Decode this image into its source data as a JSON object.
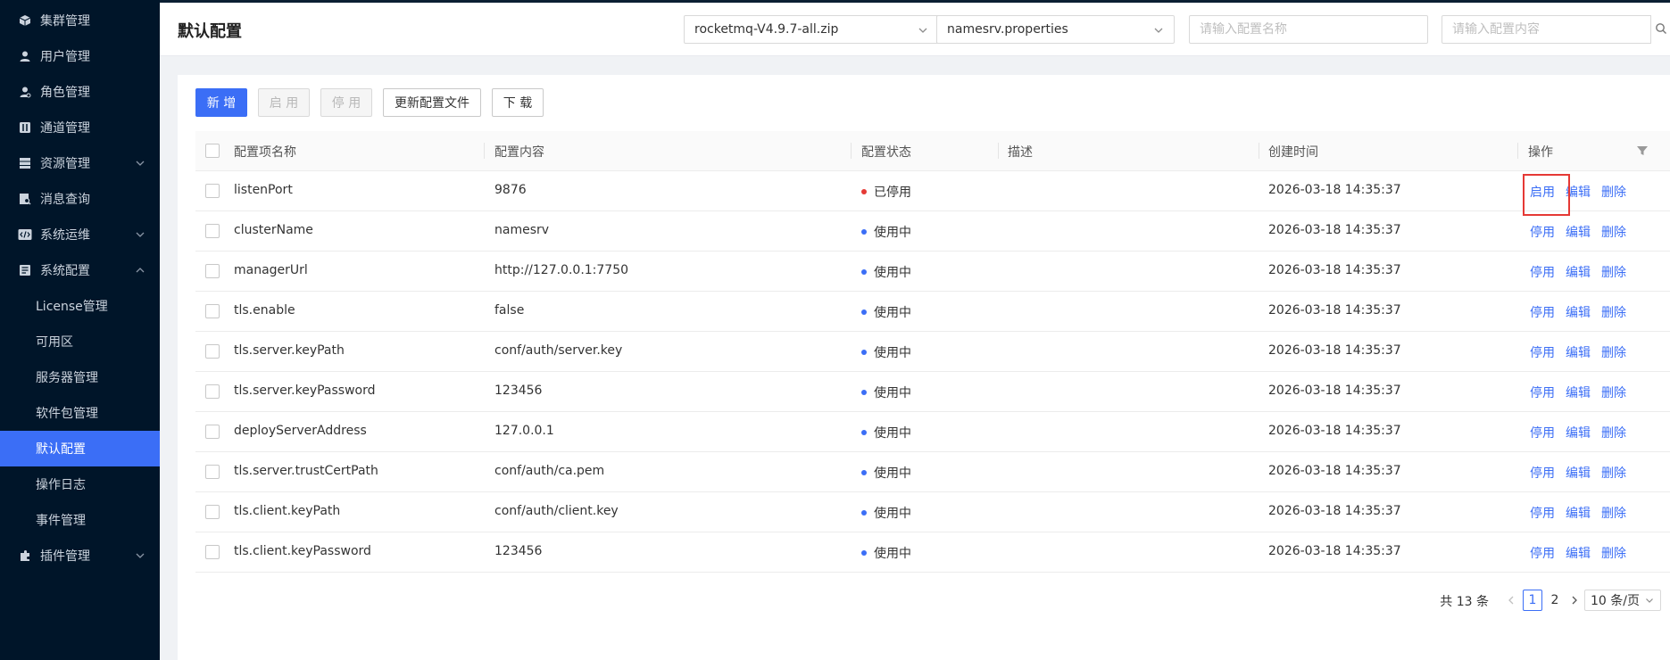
{
  "sidebar": {
    "items": [
      {
        "label": "集群管理",
        "icon": "cube-icon"
      },
      {
        "label": "用户管理",
        "icon": "user-icon"
      },
      {
        "label": "角色管理",
        "icon": "role-icon"
      },
      {
        "label": "通道管理",
        "icon": "channel-icon"
      },
      {
        "label": "资源管理",
        "icon": "server-icon",
        "expandable": true
      },
      {
        "label": "消息查询",
        "icon": "search-doc-icon"
      },
      {
        "label": "系统运维",
        "icon": "code-icon",
        "expandable": true
      },
      {
        "label": "系统配置",
        "icon": "config-icon",
        "expanded": true
      }
    ],
    "sub_items": [
      {
        "label": "License管理"
      },
      {
        "label": "可用区"
      },
      {
        "label": "服务器管理"
      },
      {
        "label": "软件包管理"
      },
      {
        "label": "默认配置",
        "active": true
      },
      {
        "label": "操作日志"
      },
      {
        "label": "事件管理"
      }
    ],
    "last_item": {
      "label": "插件管理",
      "icon": "plugin-icon",
      "expandable": true
    }
  },
  "header": {
    "title": "默认配置",
    "package_select": "rocketmq-V4.9.7-all.zip",
    "file_select": "namesrv.properties",
    "name_placeholder": "请输入配置名称",
    "content_placeholder": "请输入配置内容"
  },
  "toolbar": {
    "add_label": "新 增",
    "enable_label": "启 用",
    "disable_label": "停 用",
    "update_label": "更新配置文件",
    "download_label": "下 载"
  },
  "table": {
    "columns": [
      "配置项名称",
      "配置内容",
      "配置状态",
      "描述",
      "创建时间",
      "操作"
    ],
    "rows": [
      {
        "name": "listenPort",
        "content": "9876",
        "status": "已停用",
        "status_color": "#e53935",
        "desc": "",
        "time": "2026-03-18 14:35:37",
        "toggle": "启用"
      },
      {
        "name": "clusterName",
        "content": "namesrv",
        "status": "使用中",
        "status_color": "#3b6ef6",
        "desc": "",
        "time": "2026-03-18 14:35:37",
        "toggle": "停用"
      },
      {
        "name": "managerUrl",
        "content": "http://127.0.0.1:7750",
        "status": "使用中",
        "status_color": "#3b6ef6",
        "desc": "",
        "time": "2026-03-18 14:35:37",
        "toggle": "停用"
      },
      {
        "name": "tls.enable",
        "content": "false",
        "status": "使用中",
        "status_color": "#3b6ef6",
        "desc": "",
        "time": "2026-03-18 14:35:37",
        "toggle": "停用"
      },
      {
        "name": "tls.server.keyPath",
        "content": "conf/auth/server.key",
        "status": "使用中",
        "status_color": "#3b6ef6",
        "desc": "",
        "time": "2026-03-18 14:35:37",
        "toggle": "停用"
      },
      {
        "name": "tls.server.keyPassword",
        "content": "123456",
        "status": "使用中",
        "status_color": "#3b6ef6",
        "desc": "",
        "time": "2026-03-18 14:35:37",
        "toggle": "停用"
      },
      {
        "name": "deployServerAddress",
        "content": "127.0.0.1",
        "status": "使用中",
        "status_color": "#3b6ef6",
        "desc": "",
        "time": "2026-03-18 14:35:37",
        "toggle": "停用"
      },
      {
        "name": "tls.server.trustCertPath",
        "content": "conf/auth/ca.pem",
        "status": "使用中",
        "status_color": "#3b6ef6",
        "desc": "",
        "time": "2026-03-18 14:35:37",
        "toggle": "停用"
      },
      {
        "name": "tls.client.keyPath",
        "content": "conf/auth/client.key",
        "status": "使用中",
        "status_color": "#3b6ef6",
        "desc": "",
        "time": "2026-03-18 14:35:37",
        "toggle": "停用"
      },
      {
        "name": "tls.client.keyPassword",
        "content": "123456",
        "status": "使用中",
        "status_color": "#3b6ef6",
        "desc": "",
        "time": "2026-03-18 14:35:37",
        "toggle": "停用"
      }
    ],
    "edit_label": "编辑",
    "delete_label": "删除"
  },
  "pagination": {
    "total": "共 13 条",
    "pages": [
      "1",
      "2"
    ],
    "current": "1",
    "page_size": "10 条/页"
  },
  "colors": {
    "sidebar_bg": "#001529",
    "accent": "#3b6ef6",
    "stopped": "#e53935",
    "highlight": "#e53935"
  }
}
